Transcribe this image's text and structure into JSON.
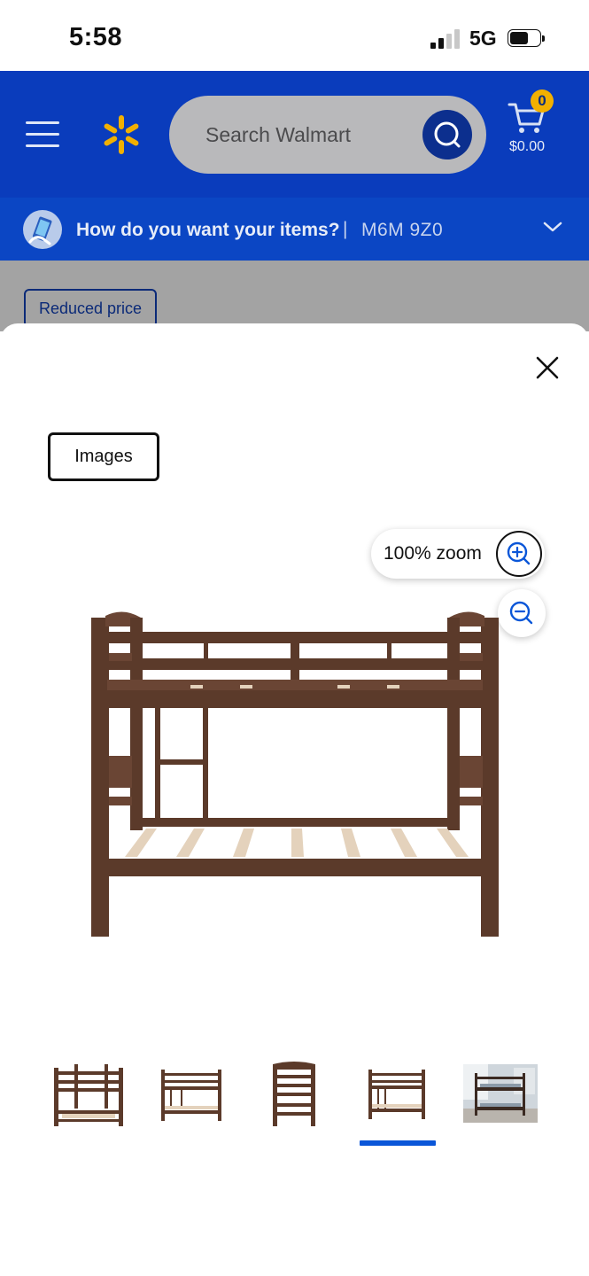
{
  "status_bar": {
    "time": "5:58",
    "network": "5G"
  },
  "header": {
    "search_placeholder": "Search Walmart",
    "cart_count": "0",
    "cart_total": "$0.00"
  },
  "delivery": {
    "question": "How do you want your items?",
    "separator": "|",
    "postal_code": "M6M 9Z0"
  },
  "background_page": {
    "badge": "Reduced price"
  },
  "viewer": {
    "tab_label": "Images",
    "zoom_label": "100% zoom",
    "thumbnails": [
      {
        "name": "bunk-bed-angled-view"
      },
      {
        "name": "bunk-bed-front-view"
      },
      {
        "name": "bunk-bed-side-view"
      },
      {
        "name": "bunk-bed-front-view-2",
        "selected": true
      },
      {
        "name": "bunk-bed-room-view"
      }
    ]
  },
  "colors": {
    "header_blue": "#0a3cbc",
    "delivery_blue": "#0b46c4",
    "spark_yellow": "#f2b000",
    "wood": "#5b3a2a",
    "selected_indicator": "#0a56d8"
  }
}
